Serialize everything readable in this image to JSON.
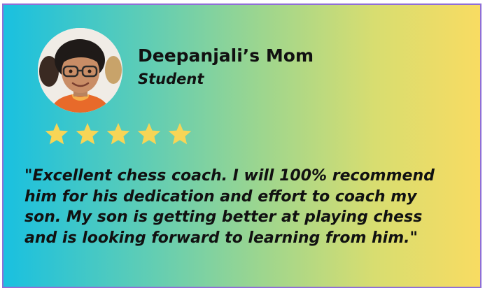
{
  "testimonial": {
    "name": "Deepanjali’s Mom",
    "role": "Student",
    "avatar_icon": "student-portrait-avatar",
    "rating": {
      "value": 5,
      "max": 5,
      "star_icon": "star-icon",
      "star_color": "#f7d556"
    },
    "quote_lines": [
      "\"Excellent chess coach. I will 100% recommend",
      "him for his dedication and effort to coach my",
      "son. My son is getting better at playing chess",
      "and is looking forward to learning from him.\""
    ]
  },
  "colors": {
    "border": "#8f6fd6",
    "gradient_start": "#19c0e0",
    "gradient_end": "#f8dc62",
    "text": "#111111"
  }
}
